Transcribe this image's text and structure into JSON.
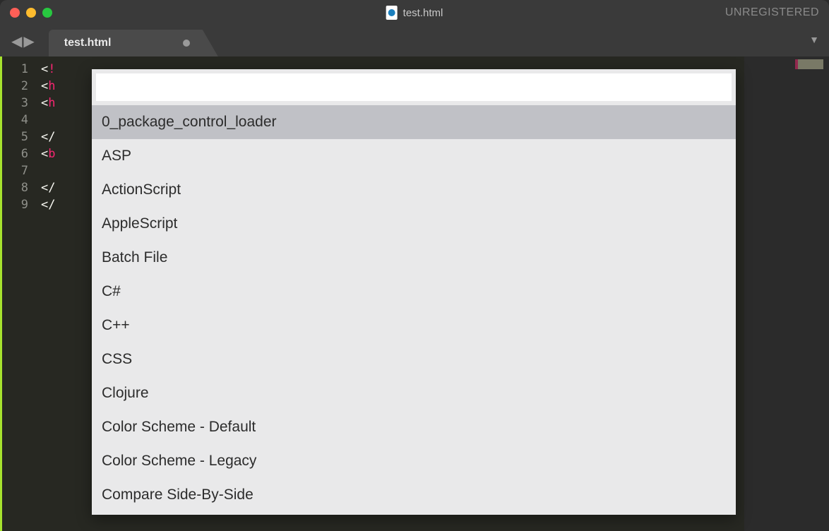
{
  "titlebar": {
    "filename": "test.html",
    "registration": "UNREGISTERED"
  },
  "tabbar": {
    "nav_back": "◀",
    "nav_forward": "▶",
    "menu_icon": "▼",
    "tabs": [
      {
        "label": "test.html",
        "dirty": true
      }
    ]
  },
  "editor": {
    "line_numbers": [
      "1",
      "2",
      "3",
      "4",
      "5",
      "6",
      "7",
      "8",
      "9"
    ],
    "code_fragments": [
      {
        "prefix": "<",
        "tag": "!"
      },
      {
        "prefix": "<",
        "tag": "h"
      },
      {
        "prefix": "<",
        "tag": "h"
      },
      {
        "prefix": "",
        "tag": ""
      },
      {
        "prefix": "</",
        "tag": ""
      },
      {
        "prefix": "<",
        "tag": "b"
      },
      {
        "prefix": "",
        "tag": ""
      },
      {
        "prefix": "</",
        "tag": ""
      },
      {
        "prefix": "</",
        "tag": ""
      }
    ]
  },
  "palette": {
    "input_value": "",
    "input_placeholder": "",
    "selected_index": 0,
    "items": [
      "0_package_control_loader",
      "ASP",
      "ActionScript",
      "AppleScript",
      "Batch File",
      "C#",
      "C++",
      "CSS",
      "Clojure",
      "Color Scheme - Default",
      "Color Scheme - Legacy",
      "Compare Side-By-Side"
    ]
  }
}
